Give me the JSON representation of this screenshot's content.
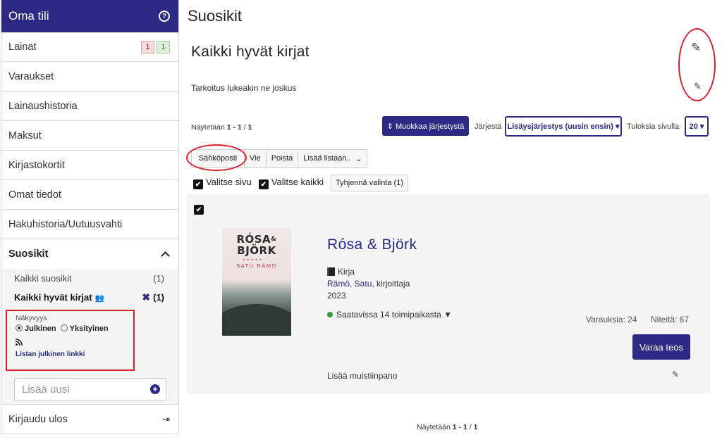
{
  "sidebar": {
    "title": "Oma tili",
    "help_icon": "?",
    "items": [
      {
        "label": "Lainat",
        "badges": [
          "1",
          "1"
        ]
      },
      {
        "label": "Varaukset"
      },
      {
        "label": "Lainaushistoria"
      },
      {
        "label": "Maksut"
      },
      {
        "label": "Kirjastokortit"
      },
      {
        "label": "Omat tiedot"
      },
      {
        "label": "Hakuhistoria/Uutuusvahti"
      }
    ],
    "favorites": {
      "label": "Suosikit",
      "lists": [
        {
          "label": "Kaikki suosikit",
          "count": "(1)"
        },
        {
          "label": "Kaikki hyvät kirjat",
          "count": "(1)",
          "delete_icon": "✖"
        }
      ],
      "visibility": {
        "label": "Näkyvyys",
        "public": "Julkinen",
        "private": "Yksityinen",
        "selected": "Julkinen",
        "rss_icon": "rss-icon",
        "public_link": "Listan julkinen linkki"
      },
      "add_new_placeholder": "Lisää uusi",
      "add_icon": "+"
    },
    "logout": "Kirjaudu ulos",
    "logout_icon": "⇥"
  },
  "main": {
    "page_title": "Suosikit",
    "list_title": "Kaikki hyvät kirjat",
    "list_description": "Tarkoitus lukeakin ne joskus",
    "edit_icon": "✎",
    "showing_prefix": "Näytetään",
    "showing_range": "1 - 1",
    "showing_sep": "/",
    "showing_total": "1",
    "edit_order_button": "⇕ Muokkaa järjestystä",
    "sort_label": "Järjestä",
    "sort_value": "Lisäysjärjestys (uusin ensin) ▾",
    "per_page_label": "Tuloksia sivulla",
    "per_page_value": "20 ▾",
    "toolbar": {
      "email": "Sähköposti",
      "export": "Vie",
      "delete": "Poista",
      "add_to_list": "Lisää listaan..",
      "add_to_list_icon": "⌄"
    },
    "select_page": "Valitse sivu",
    "select_all": "Valitse kaikki",
    "clear_selection": "Tyhjennä valinta (1)",
    "checkmark": "✔"
  },
  "record": {
    "cover_title_line1": "RÓSA",
    "cover_amp": "&",
    "cover_title_line2": "BJÖRK",
    "cover_author": "SATU RÄMÖ",
    "title": "Rósa & Björk",
    "format": "Kirja",
    "author_link": "Rämö, Satu",
    "author_role": ", kirjoittaja",
    "year": "2023",
    "availability": "Saatavissa 14 toimipaikasta ▼",
    "holds": "Varauksia: 24",
    "copies": "Niteitä: 67",
    "reserve_button": "Varaa teos",
    "add_note": "Lisää muistiinpano"
  },
  "colors": {
    "accent": "#2c2a85",
    "annotation_red": "#d9202a",
    "available_green": "#2e9b3e"
  }
}
